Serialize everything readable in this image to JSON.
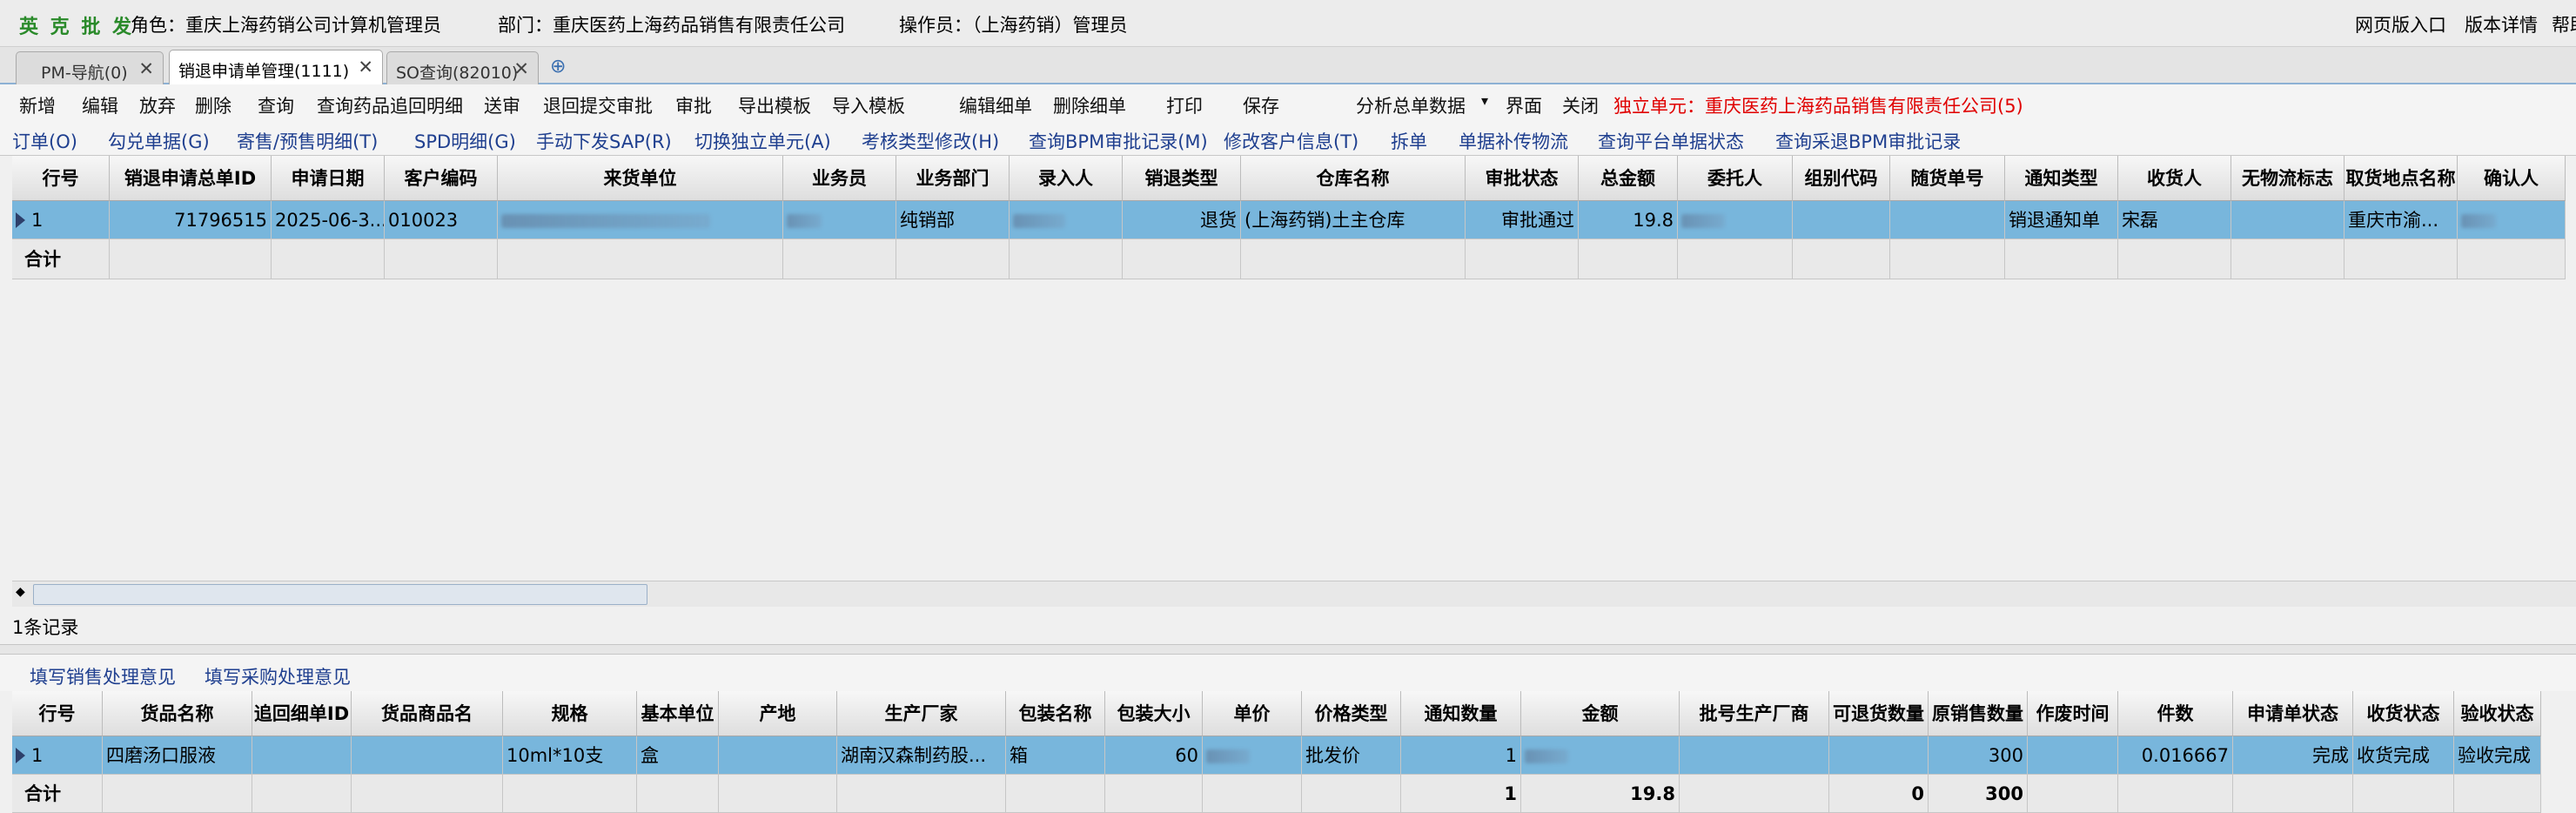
{
  "header": {
    "brand": "英 克 批 发",
    "role": "角色：重庆上海药销公司计算机管理员",
    "dept": "部门：重庆医药上海药品销售有限责任公司",
    "operator": "操作员：（上海药销）管理员",
    "links": [
      "网页版入口",
      "版本详情",
      "帮助"
    ]
  },
  "tabs": [
    {
      "label": "PM-导航(0)"
    },
    {
      "label": "销退申请单管理(1111)"
    },
    {
      "label": "SO查询(82010)"
    }
  ],
  "toolbar1": {
    "buttons": [
      "新增",
      "编辑",
      "放弃",
      "删除",
      "查询",
      "查询药品追回明细",
      "送审",
      "退回提交审批",
      "审批",
      "导出模板",
      "导入模板",
      "编辑细单",
      "删除细单",
      "打印",
      "保存",
      "分析总单数据",
      "界面",
      "关闭"
    ],
    "unit_label": "独立单元：重庆医药上海药品销售有限责任公司(5)",
    "unit_color": "#e00000"
  },
  "toolbar2": {
    "buttons": [
      "订单(O)",
      "勾兑单据(G)",
      "寄售/预售明细(T)",
      "SPD明细(G)",
      "手动下发SAP(R)",
      "切换独立单元(A)",
      "考核类型修改(H)",
      "查询BPM审批记录(M)",
      "修改客户信息(T)",
      "拆单",
      "单据补传物流",
      "查询平台单据状态",
      "查询采退BPM审批记录"
    ]
  },
  "main_grid": {
    "headers": [
      "行号",
      "销退申请总单ID",
      "申请日期",
      "客户编码",
      "来货单位",
      "业务员",
      "业务部门",
      "录入人",
      "销退类型",
      "仓库名称",
      "审批状态",
      "总金额",
      "委托人",
      "组别代码",
      "随货单号",
      "通知类型",
      "收货人",
      "无物流标志",
      "取货地点名称",
      "确认人"
    ],
    "row": {
      "no": "1",
      "id": "71796515",
      "date": "2025-06-3...",
      "cust": "010023",
      "dept": "纯销部",
      "type": "退货",
      "store": "(上海药销)土主仓库",
      "status": "审批通过",
      "total": "19.8",
      "notify": "销退通知单",
      "receiver": "宋磊",
      "pickup": "重庆市渝..."
    },
    "total_label": "合计"
  },
  "record_count": "1条记录",
  "opinion": {
    "sales": "填写销售处理意见",
    "purchase": "填写采购处理意见"
  },
  "detail_grid": {
    "headers": [
      "行号",
      "货品名称",
      "追回细单ID",
      "货品商品名",
      "规格",
      "基本单位",
      "产地",
      "生产厂家",
      "包装名称",
      "包装大小",
      "单价",
      "价格类型",
      "通知数量",
      "金额",
      "批号生产厂商",
      "可退货数量",
      "原销售数量",
      "作废时间",
      "件数",
      "申请单状态",
      "收货状态",
      "验收状态"
    ],
    "row": {
      "no": "1",
      "name": "四磨汤口服液",
      "spec": "10ml*10支",
      "unit": "盒",
      "maker": "湖南汉森制药股...",
      "pack": "箱",
      "packsize": "60",
      "pricetype": "批发价",
      "qty": "1",
      "origqty": "300",
      "pieces": "0.016667",
      "appstatus": "完成",
      "recv": "收货完成",
      "check": "验收完成"
    },
    "total": {
      "label": "合计",
      "qty": "1",
      "amount": "19.8",
      "returnable": "0",
      "origqty": "300"
    }
  }
}
